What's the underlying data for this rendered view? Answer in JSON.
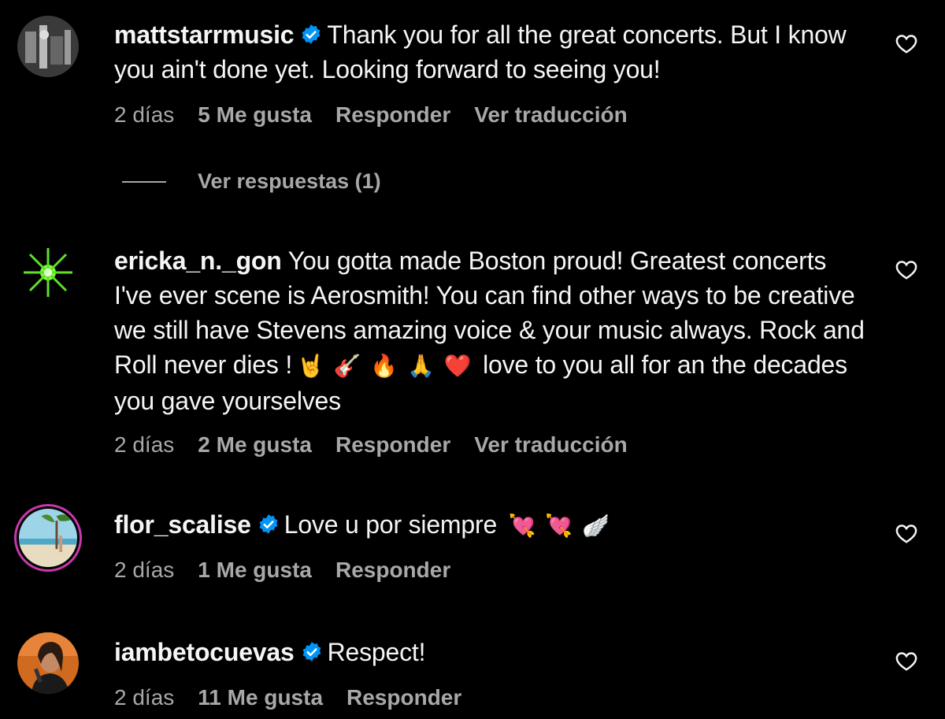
{
  "comments": [
    {
      "username": "mattstarrmusic",
      "verified": true,
      "text": "Thank you for all the great concerts. But I know you ain't done yet. Looking forward to seeing you!",
      "time": "2 días",
      "likes": "5 Me gusta",
      "reply": "Responder",
      "translate": "Ver traducción",
      "view_replies": "Ver respuestas (1)"
    },
    {
      "username": "ericka_n._gon",
      "verified": false,
      "text_before": "You gotta made Boston proud! Greatest concerts I've ever scene is Aerosmith! You can find other ways to be creative we still have Stevens amazing voice & your music always. Rock and Roll never dies !",
      "emojis": [
        "🤘",
        "🎸",
        "🔥",
        "🙏",
        "❤️"
      ],
      "text_after": "love to you all for an the decades you gave yourselves",
      "time": "2 días",
      "likes": "2 Me gusta",
      "reply": "Responder",
      "translate": "Ver traducción"
    },
    {
      "username": "flor_scalise",
      "verified": true,
      "text": "Love u por siempre",
      "emojis": [
        "💘",
        "💘",
        "🪽"
      ],
      "time": "2 días",
      "likes": "1 Me gusta",
      "reply": "Responder"
    },
    {
      "username": "iambetocuevas",
      "verified": true,
      "text": "Respect!",
      "time": "2 días",
      "likes": "11 Me gusta",
      "reply": "Responder"
    }
  ],
  "icons": {
    "like": "heart-outline-icon",
    "verified": "verified-badge-icon"
  },
  "colors": {
    "background": "#000000",
    "text": "#f5f5f5",
    "secondary": "#a8a8a8",
    "verified": "#0095f6"
  }
}
